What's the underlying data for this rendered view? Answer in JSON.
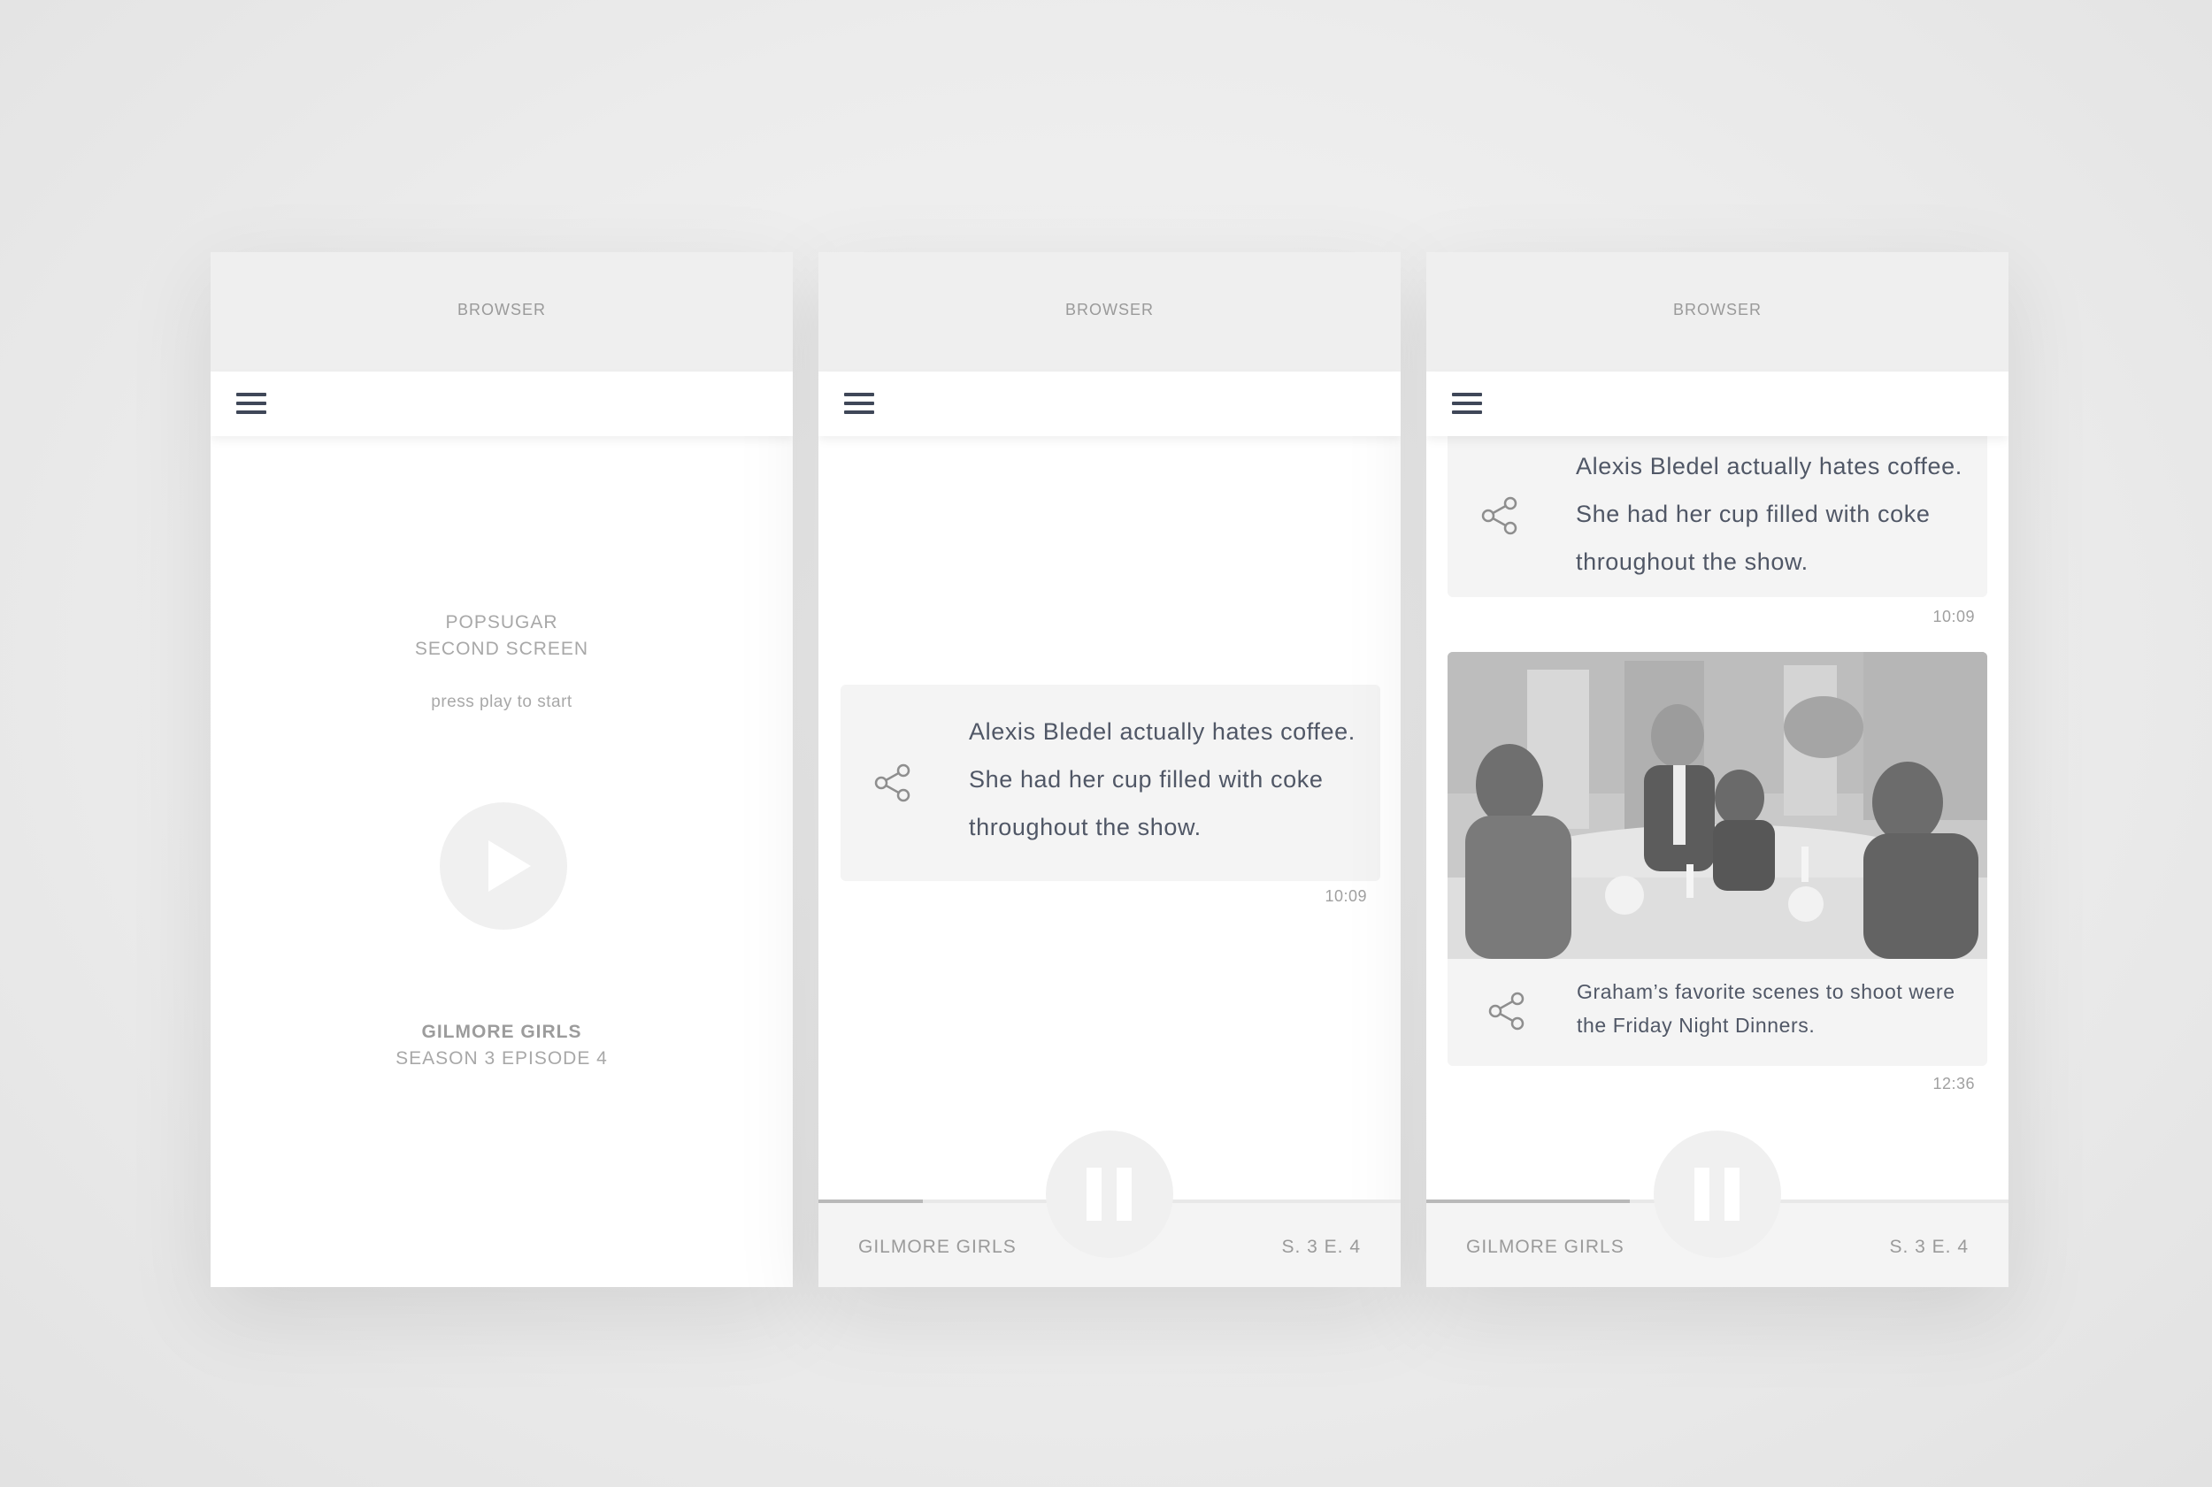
{
  "colors": {
    "browser_bar": "#efefef",
    "nav_icon": "#3f4758",
    "card_background": "#f4f4f4",
    "card_text": "#505766",
    "muted_text": "#a8a8a8",
    "control_circle": "#f0f0f0"
  },
  "screens": [
    {
      "browser_label": "BROWSER",
      "brand_line_1": "POPSUGAR",
      "brand_line_2": "SECOND SCREEN",
      "prompt": "press play to start",
      "show_title": "GILMORE GIRLS",
      "show_episode": "SEASON 3 EPISODE 4",
      "play_icon": "play-icon"
    },
    {
      "browser_label": "BROWSER",
      "card": {
        "text": "Alexis Bledel actually hates coffee. She had her cup filled with coke throughout the show.",
        "time": "10:09",
        "icon": "share-icon"
      },
      "player": {
        "title": "GILMORE GIRLS",
        "episode": "S. 3 E. 4",
        "progress": 0.18,
        "icon": "pause-icon"
      }
    },
    {
      "browser_label": "BROWSER",
      "cards": [
        {
          "text": "Alexis Bledel actually hates coffee. She had her cup filled with coke throughout the show.",
          "time": "10:09",
          "icon": "share-icon"
        },
        {
          "text": "Graham’s favorite scenes to shoot were the Friday Night Dinners.",
          "time": "12:36",
          "icon": "share-icon",
          "image": "dinner-scene-photo"
        }
      ],
      "player": {
        "title": "GILMORE GIRLS",
        "episode": "S. 3 E. 4",
        "progress": 0.35,
        "icon": "pause-icon"
      }
    }
  ]
}
